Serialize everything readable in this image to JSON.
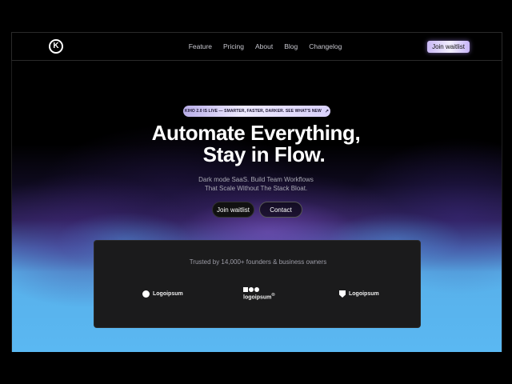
{
  "nav": {
    "logo_glyph": "K",
    "links": [
      "Feature",
      "Pricing",
      "About",
      "Blog",
      "Changelog"
    ],
    "cta": "Join waitlist"
  },
  "badge": {
    "text": "KIHO 2.0 IS LIVE — SMARTER, FASTER, DARKER.  SEE WHAT'S NEW",
    "arrow": "↗"
  },
  "hero": {
    "title_line1": "Automate Everything,",
    "title_line2": "Stay in Flow.",
    "sub_line1": "Dark mode SaaS. Build Team Workflows",
    "sub_line2": "That Scale Without The Stack Bloat.",
    "primary_cta": "Join waitlist",
    "secondary_cta": "Contact"
  },
  "trust": {
    "text": "Trusted by 14,000+ founders & business owners",
    "logos": [
      "Logoipsum",
      "logoipsum",
      "Logoipsum"
    ],
    "logo2_mark": "®"
  },
  "colors": {
    "accent": "#c9b8f5",
    "glow_blue": "#5ab8f2",
    "glow_purple": "#4a2f8a"
  }
}
